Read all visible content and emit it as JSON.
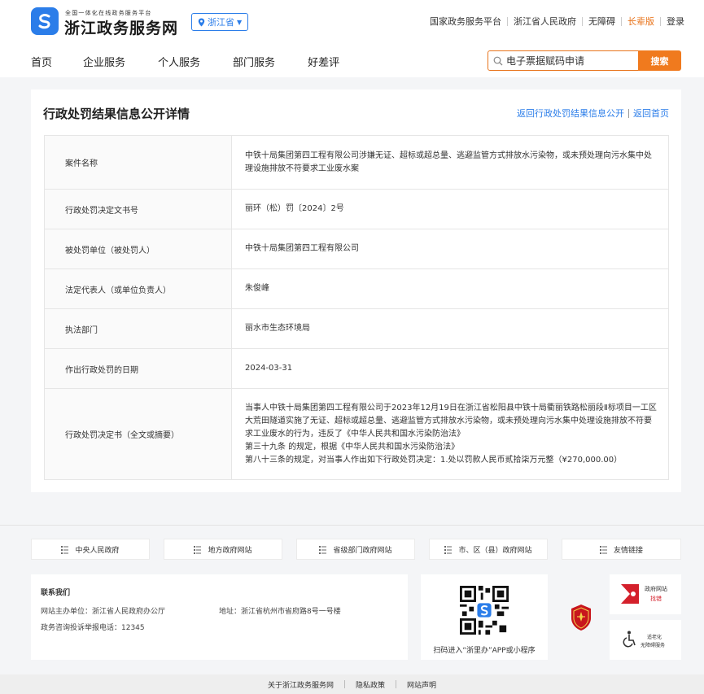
{
  "header": {
    "logo_sub": "全国一体化在线政务服务平台",
    "logo_main": "浙江政务服务网",
    "region": "浙江省",
    "top_links": [
      "国家政务服务平台",
      "浙江省人民政府",
      "无障碍",
      "长辈版",
      "登录"
    ],
    "accent_color": "#e8741c",
    "brand_color": "#2b7de9"
  },
  "nav": {
    "items": [
      "首页",
      "企业服务",
      "个人服务",
      "部门服务",
      "好差评"
    ]
  },
  "search": {
    "value": "电子票据赋码申请",
    "button": "搜索"
  },
  "detail": {
    "title": "行政处罚结果信息公开详情",
    "back_link": "返回行政处罚结果信息公开",
    "home_link": "返回首页",
    "rows": [
      {
        "label": "案件名称",
        "value": "中铁十局集团第四工程有限公司涉嫌无证、超标或超总量、逃避监管方式排放水污染物，或未预处理向污水集中处理设施排放不符要求工业废水案"
      },
      {
        "label": "行政处罚决定文书号",
        "value": "丽环（松）罚〔2024〕2号"
      },
      {
        "label": "被处罚单位（被处罚人）",
        "value": "中铁十局集团第四工程有限公司"
      },
      {
        "label": "法定代表人（或单位负责人）",
        "value": "朱俊峰"
      },
      {
        "label": "执法部门",
        "value": "丽水市生态环境局"
      },
      {
        "label": "作出行政处罚的日期",
        "value": "2024-03-31"
      },
      {
        "label": "行政处罚决定书（全文或摘要）",
        "value_lines": [
          "当事人中铁十局集团第四工程有限公司于2023年12月19日在浙江省松阳县中铁十局衢丽铁路松丽段Ⅱ标项目一工区大荒田隧道实施了无证、超标或超总量、逃避监管方式排放水污染物，或未预处理向污水集中处理设施排放不符要求工业废水的行为，违反了《中华人民共和国水污染防治法》",
          "第三十九条 的规定，根据《中华人民共和国水污染防治法》",
          "第八十三条的规定，对当事人作出如下行政处罚决定：1.处以罚款人民币贰拾柒万元整（¥270,000.00）"
        ]
      }
    ]
  },
  "footer": {
    "links": [
      "中央人民政府",
      "地方政府网站",
      "省级部门政府网站",
      "市、区（县）政府网站",
      "友情链接"
    ],
    "contact_title": "联系我们",
    "sponsor": "网站主办单位：浙江省人民政府办公厅",
    "address": "地址：浙江省杭州市省府路8号一号楼",
    "hotline": "政务咨询投诉举报电话：12345",
    "qr_caption": "扫码进入“浙里办”APP或小程序",
    "gov_error_line1": "政府网站",
    "gov_error_line2": "找错",
    "access_line1": "适老化",
    "access_line2": "无障碍服务",
    "bottom_links": [
      "关于浙江政务服务网",
      "隐私政策",
      "网站声明"
    ]
  }
}
